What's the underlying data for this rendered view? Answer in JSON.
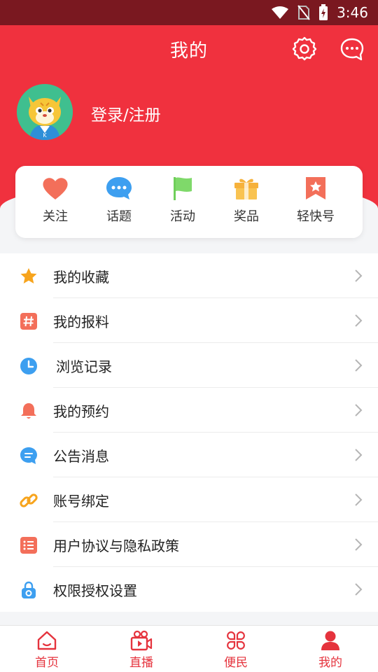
{
  "status_bar": {
    "time": "3:46"
  },
  "header": {
    "title": "我的",
    "login_label": "登录/注册"
  },
  "quick_links": [
    {
      "label": "关注",
      "icon": "heart-icon"
    },
    {
      "label": "话题",
      "icon": "chat-bubble-icon"
    },
    {
      "label": "活动",
      "icon": "flag-icon"
    },
    {
      "label": "奖品",
      "icon": "gift-icon"
    },
    {
      "label": "轻快号",
      "icon": "bookmark-star-icon"
    }
  ],
  "menu": [
    {
      "label": "我的收藏",
      "icon": "star-icon"
    },
    {
      "label": "我的报料",
      "icon": "hashtag-icon"
    },
    {
      "label": "浏览记录",
      "icon": "clock-icon"
    },
    {
      "label": "我的预约",
      "icon": "bell-icon"
    },
    {
      "label": "公告消息",
      "icon": "message-icon"
    },
    {
      "label": "账号绑定",
      "icon": "link-icon"
    },
    {
      "label": "用户协议与隐私政策",
      "icon": "list-icon"
    },
    {
      "label": "权限授权设置",
      "icon": "lock-icon"
    }
  ],
  "tabs": [
    {
      "label": "首页",
      "icon": "home-icon"
    },
    {
      "label": "直播",
      "icon": "video-camera-icon"
    },
    {
      "label": "便民",
      "icon": "clover-grid-icon"
    },
    {
      "label": "我的",
      "icon": "person-icon",
      "active": true
    }
  ],
  "colors": {
    "brand_red": "#f0313e",
    "status_bar": "#7a1820",
    "tab_red": "#e5333d"
  }
}
